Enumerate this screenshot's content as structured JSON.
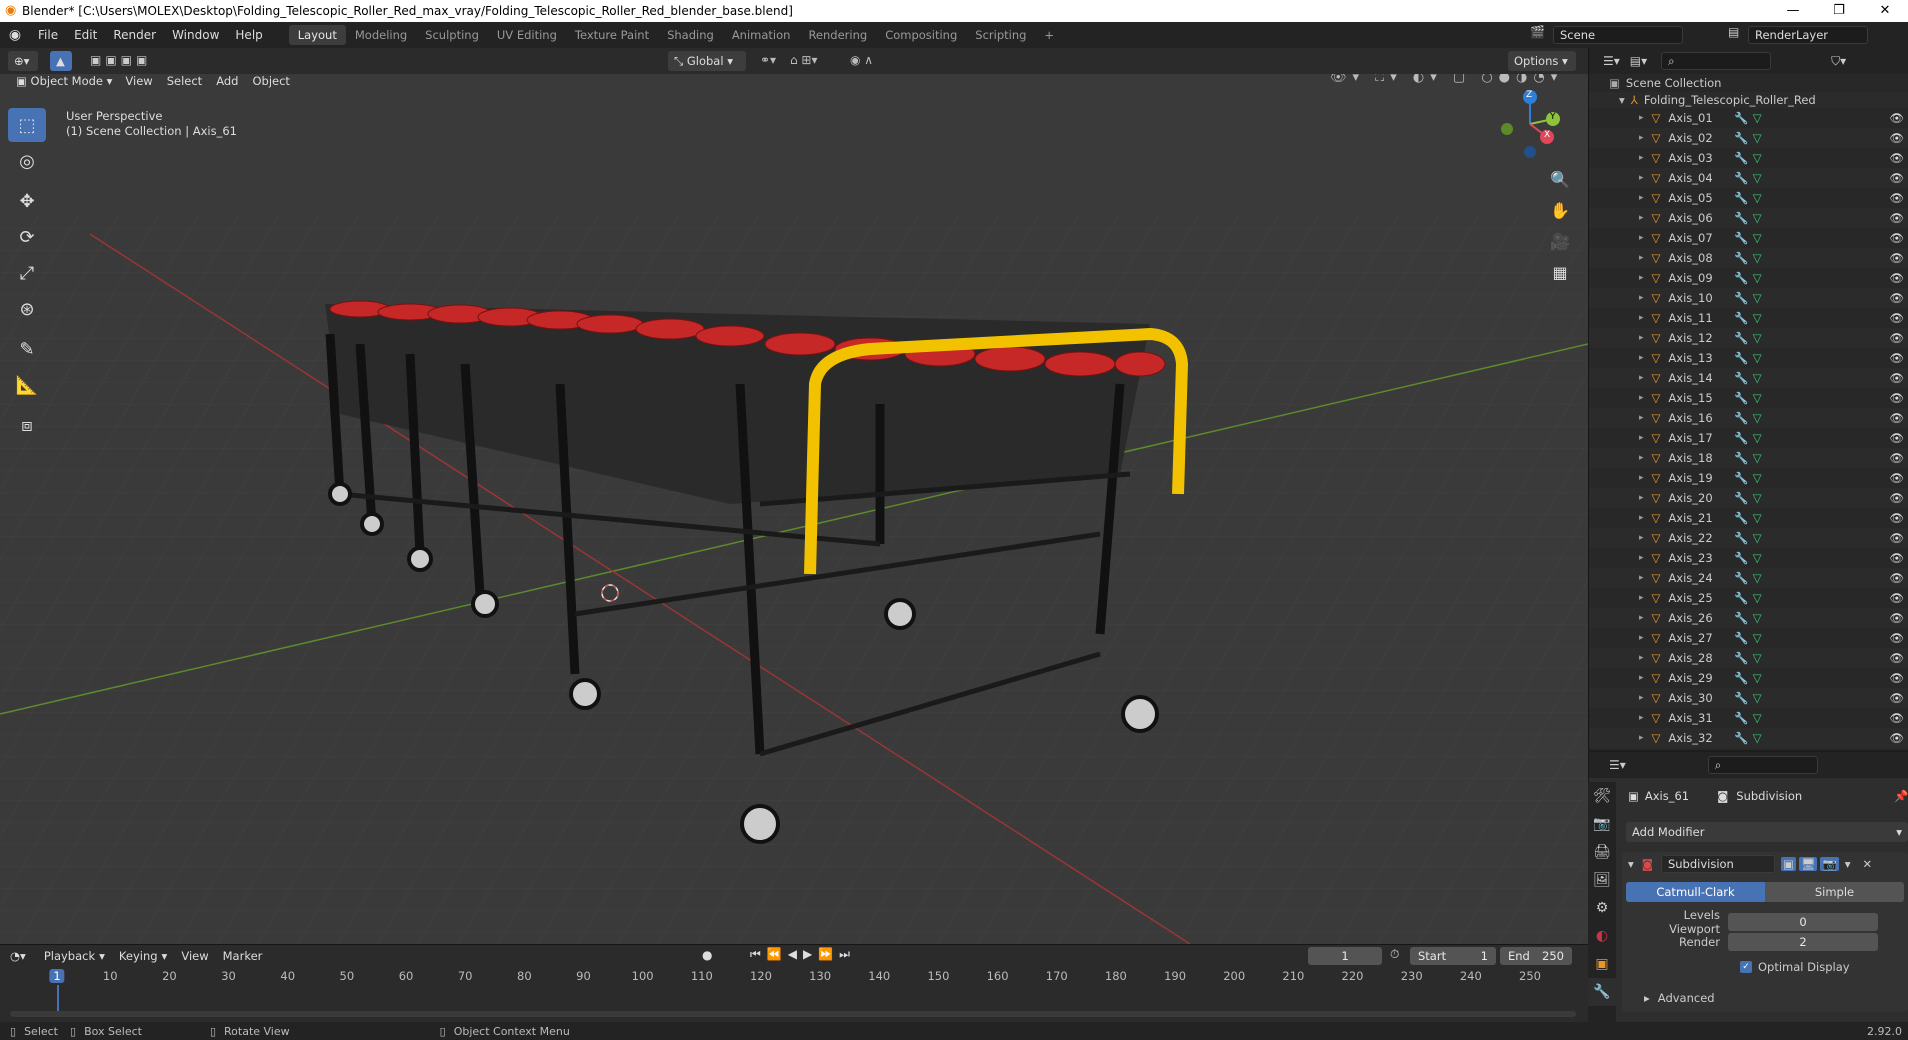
{
  "window": {
    "title": "Blender* [C:\\Users\\MOLEX\\Desktop\\Folding_Telescopic_Roller_Red_max_vray/Folding_Telescopic_Roller_Red_blender_base.blend]",
    "minimize": "—",
    "maximize": "❐",
    "close": "✕"
  },
  "menus": [
    "File",
    "Edit",
    "Render",
    "Window",
    "Help"
  ],
  "workspaces": [
    "Layout",
    "Modeling",
    "Sculpting",
    "UV Editing",
    "Texture Paint",
    "Shading",
    "Animation",
    "Rendering",
    "Compositing",
    "Scripting",
    "+"
  ],
  "active_workspace": "Layout",
  "scene": {
    "name": "Scene",
    "render_layer": "RenderLayer"
  },
  "viewport_header": {
    "transform_orientation": "Global",
    "options_label": "Options",
    "mode": "Object Mode",
    "menus": [
      "View",
      "Select",
      "Add",
      "Object"
    ]
  },
  "viewport": {
    "perspective": "User Perspective",
    "collection_info": "(1) Scene Collection | Axis_61",
    "gizmo_labels": {
      "z": "Z",
      "y": "Y",
      "x": "X"
    }
  },
  "outliner": {
    "root": "Scene Collection",
    "collection": "Folding_Telescopic_Roller_Red",
    "items": [
      "Axis_01",
      "Axis_02",
      "Axis_03",
      "Axis_04",
      "Axis_05",
      "Axis_06",
      "Axis_07",
      "Axis_08",
      "Axis_09",
      "Axis_10",
      "Axis_11",
      "Axis_12",
      "Axis_13",
      "Axis_14",
      "Axis_15",
      "Axis_16",
      "Axis_17",
      "Axis_18",
      "Axis_19",
      "Axis_20",
      "Axis_21",
      "Axis_22",
      "Axis_23",
      "Axis_24",
      "Axis_25",
      "Axis_26",
      "Axis_27",
      "Axis_28",
      "Axis_29",
      "Axis_30",
      "Axis_31",
      "Axis_32"
    ]
  },
  "properties": {
    "object": "Axis_61",
    "modifier_breadcrumb": "Subdivision",
    "add_modifier": "Add Modifier",
    "modifier_name": "Subdivision",
    "type_options": [
      "Catmull-Clark",
      "Simple"
    ],
    "active_type": "Catmull-Clark",
    "levels_viewport_label": "Levels Viewport",
    "levels_viewport": "0",
    "render_label": "Render",
    "render_levels": "2",
    "optimal_display": "Optimal Display",
    "advanced": "Advanced"
  },
  "timeline": {
    "menus": [
      "Playback",
      "Keying",
      "View",
      "Marker"
    ],
    "current_frame": "1",
    "start_label": "Start",
    "start": "1",
    "end_label": "End",
    "end": "250",
    "ticks": [
      "1",
      "10",
      "20",
      "30",
      "40",
      "50",
      "60",
      "70",
      "80",
      "90",
      "100",
      "110",
      "120",
      "130",
      "140",
      "150",
      "160",
      "170",
      "180",
      "190",
      "200",
      "210",
      "220",
      "230",
      "240",
      "250"
    ]
  },
  "statusbar": {
    "select": "Select",
    "box_select": "Box Select",
    "rotate_view": "Rotate View",
    "context_menu": "Object Context Menu",
    "version": "2.92.0"
  },
  "colors": {
    "accent": "#4772b3",
    "roller_red": "#c62828",
    "rail_yellow": "#f2c200",
    "frame_black": "#111111"
  }
}
